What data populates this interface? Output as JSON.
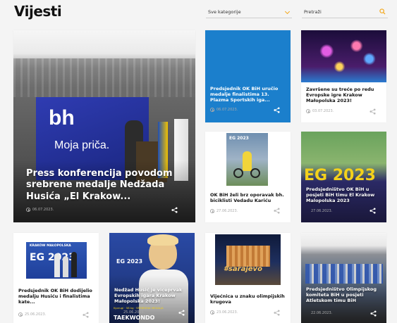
{
  "page_title": "Vijesti",
  "filters": {
    "category_value": "Sve kategorije",
    "search_placeholder": "Pretraži"
  },
  "cards": [
    {
      "title": "Press konferencija povodom srebrene medalje Nedžada Husića „El Krakow...",
      "date": "06.07.2023.",
      "image_text": [
        "bh",
        "Moja priča."
      ]
    },
    {
      "title": "Predsjednik OK BiH uručio medalje finalistima 13. Plazma Sportskih iga...",
      "date": "06.07.2023."
    },
    {
      "title": "Završene su treće po redu Evropske igre Krakow Małopolska 2023!",
      "date": "03.07.2023."
    },
    {
      "title": "OK BiH želi brz oporavak bh. biciklisti Vedadu Kariću",
      "date": "27.06.2023.",
      "image_text": [
        "EG 2023"
      ]
    },
    {
      "title": "Predsjedništvo OK BiH u posjeti BiH timu El Krakow Malopolska 2023",
      "date": "27.06.2023.",
      "image_text": [
        "EG 2023"
      ]
    },
    {
      "title": "Predsjednik OK BiH dodijelio medalju Husiću i finalistima kate...",
      "date": "25.06.2023.",
      "image_text": [
        "KRAKÓW MAŁOPOLSKA",
        "EG 2023"
      ]
    },
    {
      "title": "Nedžad Husić je viceprvak Evropskih igara Krakow Małopolska 2023!",
      "date": "25.06.2023.",
      "image_text": [
        "EG 2023",
        "TAEKWONDO",
        "Kyorugi · 58 kg · SREBRENA MEDALJA"
      ]
    },
    {
      "title": "Vijećnica u znaku olimpijskih krugova",
      "date": "23.06.2023.",
      "image_text": [
        "#sarajevo"
      ]
    },
    {
      "title": "Predsjedništvo Olimpijskog komiteta BiH u posjeti Atletskom timu BiH",
      "date": "22.06.2023."
    }
  ],
  "colors": {
    "accent": "#f3a81d",
    "blue_card": "#1b7fcc"
  }
}
